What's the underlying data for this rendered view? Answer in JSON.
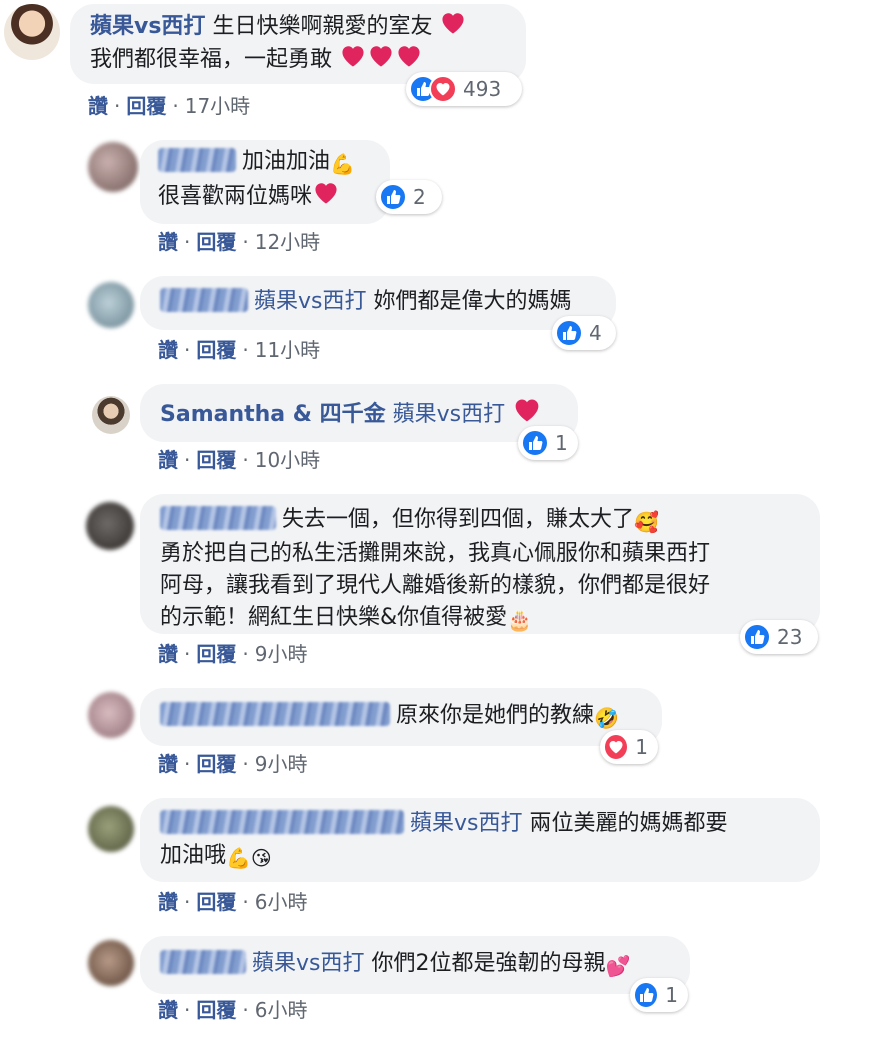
{
  "comments": [
    {
      "author": "蘋果vs西打",
      "lines": [
        "生日快樂啊親愛的室友",
        "我們都很幸福，一起勇敢"
      ],
      "reaction_count": "493",
      "actions": {
        "like": "讚",
        "reply": "回覆",
        "time": "17小時"
      }
    },
    {
      "lines": [
        "加油加油",
        "很喜歡兩位媽咪"
      ],
      "reaction_count": "2",
      "actions": {
        "like": "讚",
        "reply": "回覆",
        "time": "12小時"
      }
    },
    {
      "tag": "蘋果vs西打",
      "text": "妳們都是偉大的媽媽",
      "reaction_count": "4",
      "actions": {
        "like": "讚",
        "reply": "回覆",
        "time": "11小時"
      }
    },
    {
      "author": "Samantha & 四千金",
      "tag": "蘋果vs西打",
      "reaction_count": "1",
      "actions": {
        "like": "讚",
        "reply": "回覆",
        "time": "10小時"
      }
    },
    {
      "lines": [
        "失去一個，但你得到四個，賺太大了",
        "勇於把自己的私生活攤開來說，我真心佩服你和蘋果西打",
        "阿母，讓我看到了現代人離婚後新的樣貌，你們都是很好",
        "的示範！網紅生日快樂&你值得被愛"
      ],
      "reaction_count": "23",
      "actions": {
        "like": "讚",
        "reply": "回覆",
        "time": "9小時"
      }
    },
    {
      "text": "原來你是她們的教練",
      "reaction_count": "1",
      "actions": {
        "like": "讚",
        "reply": "回覆",
        "time": "9小時"
      }
    },
    {
      "tag": "蘋果vs西打",
      "lines": [
        "兩位美麗的媽媽都要",
        "加油哦"
      ],
      "actions": {
        "like": "讚",
        "reply": "回覆",
        "time": "6小時"
      }
    },
    {
      "tag": "蘋果vs西打",
      "text": "你們2位都是強韌的母親",
      "reaction_count": "1",
      "actions": {
        "like": "讚",
        "reply": "回覆",
        "time": "6小時"
      }
    }
  ],
  "colors": {
    "link": "#385898",
    "bubble": "#f2f3f5",
    "like": "#1877f2",
    "love": "#f33e58",
    "meta": "#606770"
  }
}
